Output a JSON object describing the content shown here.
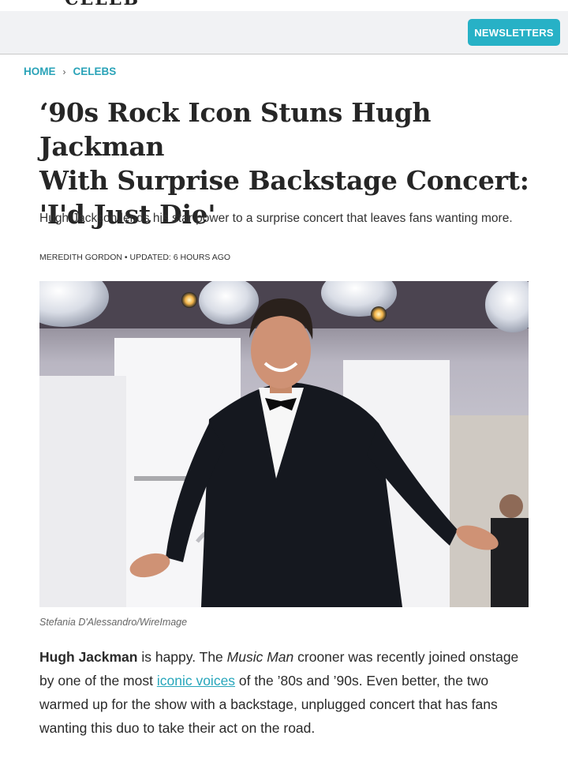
{
  "site": {
    "logo_fragment": "CELEB"
  },
  "header": {
    "newsletters_label": "NEWSLETTERS"
  },
  "breadcrumb": {
    "home": "HOME",
    "separator": "›",
    "section": "CELEBS"
  },
  "article": {
    "headline_line1": "‘90s Rock Icon Stuns Hugh Jackman",
    "headline_line2": "With Surprise Backstage Concert:",
    "headline_line3": "'I'd Just Die'",
    "dek": "Hugh Jackson lends his star power to a surprise concert that leaves fans wanting more.",
    "byline_author": "MEREDITH GORDON",
    "byline_sep": " • ",
    "byline_updated": "UPDATED: 6 HOURS AGO",
    "image_caption": "Stefania D'Alessandro/WireImage",
    "body_bold": "Hugh Jackman",
    "body_part1": " is happy. The ",
    "body_italic": "Music Man",
    "body_part2": " crooner was recently joined onstage by one of the most ",
    "body_link": "iconic voices",
    "body_part3": " of the ’80s and ’90s. Even better, the two warmed up for the show with a backstage, unplugged concert that has fans wanting this duo to take their act on the road."
  },
  "colors": {
    "accent": "#27b1c6",
    "header_bg": "#f1f2f4",
    "text": "#222222"
  },
  "icons": {
    "breadcrumb_separator": "chevron-right-icon"
  }
}
